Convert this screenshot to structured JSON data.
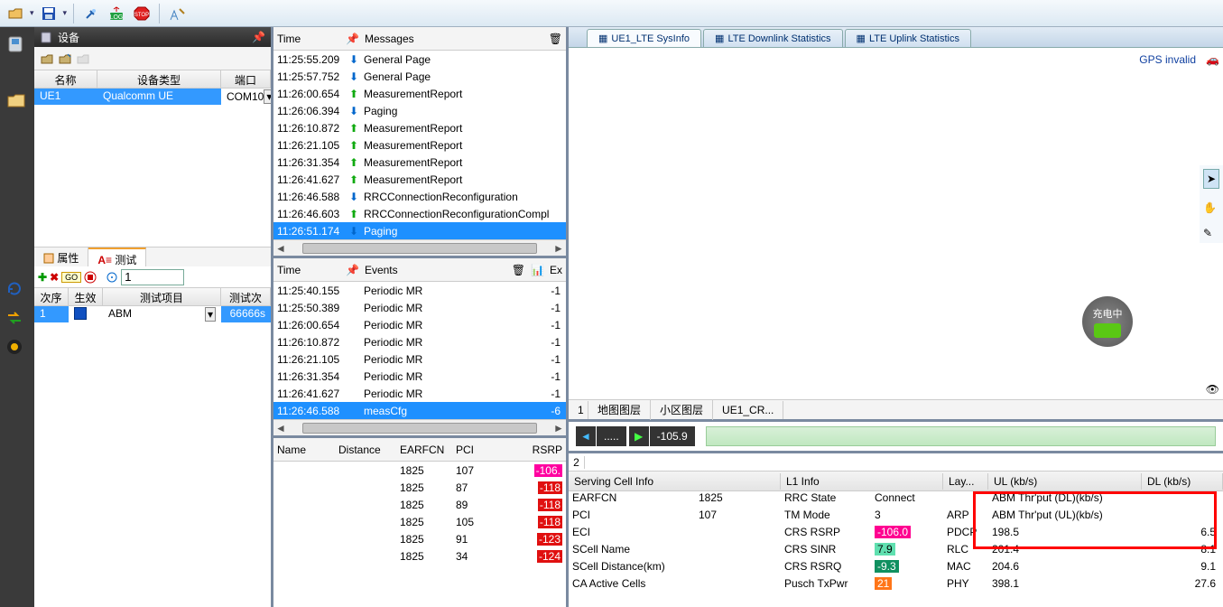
{
  "toolbar": {},
  "device_panel": {
    "title": "设备",
    "cols": {
      "name": "名称",
      "type": "设备类型",
      "port": "端口"
    },
    "row": {
      "name": "UE1",
      "type": "Qualcomm UE",
      "port": "COM10"
    }
  },
  "prop_tabs": {
    "prop": "属性",
    "test": "测试"
  },
  "test_input": "1",
  "test_cols": {
    "seq": "次序",
    "eff": "生效",
    "item": "测试项目",
    "count": "测试次数"
  },
  "test_row": {
    "seq": "1",
    "item": "ABM",
    "count": "66666s"
  },
  "messages": {
    "time_hd": "Time",
    "msg_hd": "Messages",
    "rows": [
      {
        "t": "11:25:55.209",
        "dir": "down",
        "m": "General Page"
      },
      {
        "t": "11:25:57.752",
        "dir": "down",
        "m": "General Page"
      },
      {
        "t": "11:26:00.654",
        "dir": "up",
        "m": "MeasurementReport"
      },
      {
        "t": "11:26:06.394",
        "dir": "down",
        "m": "Paging"
      },
      {
        "t": "11:26:10.872",
        "dir": "up",
        "m": "MeasurementReport"
      },
      {
        "t": "11:26:21.105",
        "dir": "up",
        "m": "MeasurementReport"
      },
      {
        "t": "11:26:31.354",
        "dir": "up",
        "m": "MeasurementReport"
      },
      {
        "t": "11:26:41.627",
        "dir": "up",
        "m": "MeasurementReport"
      },
      {
        "t": "11:26:46.588",
        "dir": "down",
        "m": "RRCConnectionReconfiguration"
      },
      {
        "t": "11:26:46.603",
        "dir": "up",
        "m": "RRCConnectionReconfigurationCompl"
      },
      {
        "t": "11:26:51.174",
        "dir": "down",
        "m": "Paging",
        "sel": true
      }
    ]
  },
  "events": {
    "time_hd": "Time",
    "ev_hd": "Events",
    "ex_hd": "Ex",
    "rows": [
      {
        "t": "11:25:40.155",
        "m": "Periodic MR",
        "v": "-1"
      },
      {
        "t": "11:25:50.389",
        "m": "Periodic MR",
        "v": "-1"
      },
      {
        "t": "11:26:00.654",
        "m": "Periodic MR",
        "v": "-1"
      },
      {
        "t": "11:26:10.872",
        "m": "Periodic MR",
        "v": "-1"
      },
      {
        "t": "11:26:21.105",
        "m": "Periodic MR",
        "v": "-1"
      },
      {
        "t": "11:26:31.354",
        "m": "Periodic MR",
        "v": "-1"
      },
      {
        "t": "11:26:41.627",
        "m": "Periodic MR",
        "v": "-1"
      },
      {
        "t": "11:26:46.588",
        "m": "measCfg",
        "v": "-6",
        "sel": true
      }
    ]
  },
  "cells": {
    "cols": {
      "name": "Name",
      "dist": "Distance",
      "earfcn": "EARFCN",
      "pci": "PCI",
      "rsrp": "RSRP"
    },
    "rows": [
      {
        "earfcn": "1825",
        "pci": "107",
        "rsrp": "-106.",
        "cls": "mag"
      },
      {
        "earfcn": "1825",
        "pci": "87",
        "rsrp": "-118",
        "cls": "red"
      },
      {
        "earfcn": "1825",
        "pci": "89",
        "rsrp": "-118",
        "cls": "red"
      },
      {
        "earfcn": "1825",
        "pci": "105",
        "rsrp": "-118",
        "cls": "red"
      },
      {
        "earfcn": "1825",
        "pci": "91",
        "rsrp": "-123",
        "cls": "red"
      },
      {
        "earfcn": "1825",
        "pci": "34",
        "rsrp": "-124",
        "cls": "red"
      }
    ]
  },
  "top_tabs": {
    "t1": "UE1_LTE SysInfo",
    "t2": "LTE Downlink Statistics",
    "t3": "LTE Uplink Statistics"
  },
  "gps": "GPS invalid",
  "battery": "充电中",
  "map_tabs": {
    "n": "1",
    "a": "地图图层",
    "b": "小区图层",
    "c": "UE1_CR..."
  },
  "playback": {
    "n": "2",
    "val": "-105.9",
    "dots": "....."
  },
  "serving": {
    "hd": "Serving Cell Info",
    "rows": [
      {
        "k": "EARFCN",
        "v": "1825"
      },
      {
        "k": "PCI",
        "v": "107"
      },
      {
        "k": "ECI",
        "v": ""
      },
      {
        "k": "SCell Name",
        "v": ""
      },
      {
        "k": "SCell Distance(km)",
        "v": ""
      },
      {
        "k": "CA Active Cells",
        "v": ""
      }
    ]
  },
  "l1": {
    "hd": "L1 Info",
    "rows": [
      {
        "k": "RRC State",
        "v": "Connect"
      },
      {
        "k": "TM Mode",
        "v": "3"
      },
      {
        "k": "CRS RSRP",
        "v": "-106.0",
        "cls": "crsrp"
      },
      {
        "k": "CRS SINR",
        "v": "7.9",
        "cls": "sinr"
      },
      {
        "k": "CRS RSRQ",
        "v": "-9.3",
        "cls": "rsrq"
      },
      {
        "k": "Pusch TxPwr",
        "v": "21",
        "cls": "tx"
      }
    ]
  },
  "lay": {
    "hd": "Lay...",
    "rows": [
      "",
      "ARP",
      "PDCP",
      "RLC",
      "MAC",
      "PHY"
    ]
  },
  "ul": {
    "hd": "UL (kb/s)",
    "rows": [
      "ABM Thr'put (DL)(kb/s)",
      "ABM Thr'put (UL)(kb/s)",
      "198.5",
      "201.4",
      "204.6",
      "398.1"
    ]
  },
  "dl": {
    "hd": "DL (kb/s)",
    "rows": [
      "",
      "",
      "6.5",
      "8.1",
      "9.1",
      "27.6"
    ]
  }
}
